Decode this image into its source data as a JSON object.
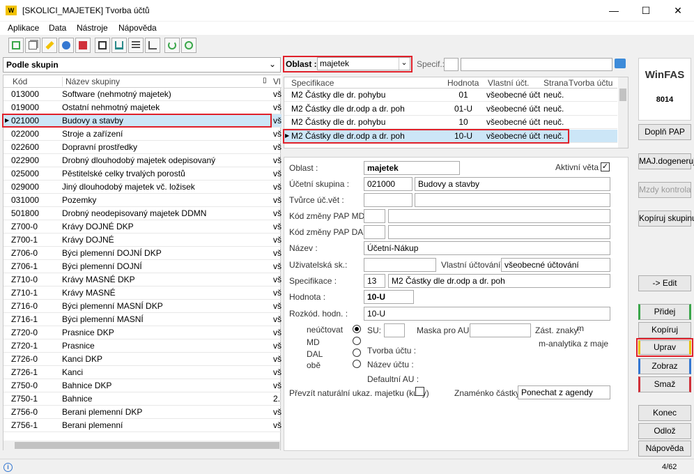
{
  "window": {
    "logo": "W",
    "title": "[SKOLICI_MAJETEK] Tvorba účtů",
    "min": "—",
    "max": "☐",
    "close": "✕"
  },
  "menu": [
    "Aplikace",
    "Data",
    "Nástroje",
    "Nápověda"
  ],
  "toolbar_icons": [
    "add-icon",
    "copy-icon",
    "edit-icon",
    "view-icon",
    "delete-icon",
    "print-icon",
    "export-icon",
    "list-icon",
    "tree-icon",
    "refresh-icon",
    "help-icon"
  ],
  "left": {
    "grouping": "Podle skupin",
    "headers": {
      "kod": "Kód",
      "nazev": "Název skupiny",
      "vl": "Vl"
    },
    "rows": [
      {
        "kod": "013000",
        "nazev": "Software (nehmotný majetek)",
        "vl": "vš"
      },
      {
        "kod": "019000",
        "nazev": "Ostatní nehmotný majetek",
        "vl": "vš"
      },
      {
        "kod": "021000",
        "nazev": "Budovy a stavby",
        "vl": "vš"
      },
      {
        "kod": "022000",
        "nazev": "Stroje a zařízení",
        "vl": "vš"
      },
      {
        "kod": "022600",
        "nazev": "Dopravní prostředky",
        "vl": "vš"
      },
      {
        "kod": "022900",
        "nazev": "Drobný dlouhodobý majetek odepisovaný",
        "vl": "vš"
      },
      {
        "kod": "025000",
        "nazev": "Pěstitelské celky trvalých porostů",
        "vl": "vš"
      },
      {
        "kod": "029000",
        "nazev": "Jiný dlouhodobý majetek vč. ložisek",
        "vl": "vš"
      },
      {
        "kod": "031000",
        "nazev": "Pozemky",
        "vl": "vš"
      },
      {
        "kod": "501800",
        "nazev": "Drobný neodepisovaný majetek DDMN",
        "vl": "vš"
      },
      {
        "kod": "Z700-0",
        "nazev": "Krávy DOJNÉ DKP",
        "vl": "vš"
      },
      {
        "kod": "Z700-1",
        "nazev": "Krávy DOJNÉ",
        "vl": "vš"
      },
      {
        "kod": "Z706-0",
        "nazev": "Býci plemenní DOJNÍ DKP",
        "vl": "vš"
      },
      {
        "kod": "Z706-1",
        "nazev": "Býci plemenní DOJNÍ",
        "vl": "vš"
      },
      {
        "kod": "Z710-0",
        "nazev": "Krávy MASNÉ DKP",
        "vl": "vš"
      },
      {
        "kod": "Z710-1",
        "nazev": "Krávy MASNÉ",
        "vl": "vš"
      },
      {
        "kod": "Z716-0",
        "nazev": "Býci plemenní MASNÍ DKP",
        "vl": "vš"
      },
      {
        "kod": "Z716-1",
        "nazev": "Býci plemenní MASNÍ",
        "vl": "vš"
      },
      {
        "kod": "Z720-0",
        "nazev": "Prasnice DKP",
        "vl": "vš"
      },
      {
        "kod": "Z720-1",
        "nazev": "Prasnice",
        "vl": "vš"
      },
      {
        "kod": "Z726-0",
        "nazev": "Kanci DKP",
        "vl": "vš"
      },
      {
        "kod": "Z726-1",
        "nazev": "Kanci",
        "vl": "vš"
      },
      {
        "kod": "Z750-0",
        "nazev": "Bahnice DKP",
        "vl": "vš"
      },
      {
        "kod": "Z750-1",
        "nazev": "Bahnice",
        "vl": "2."
      },
      {
        "kod": "Z756-0",
        "nazev": "Berani plemenní DKP",
        "vl": "vš"
      },
      {
        "kod": "Z756-1",
        "nazev": "Berani plemenní",
        "vl": "vš"
      }
    ]
  },
  "filter": {
    "oblast_label": "Oblast :",
    "oblast_value": "majetek",
    "specif_label": "Specif.:"
  },
  "spec": {
    "headers": {
      "spec": "Specifikace",
      "hod": "Hodnota",
      "vl": "Vlastní účt.",
      "str": "Strana",
      "tvorba": "Tvorba účtu"
    },
    "rows": [
      {
        "spec": "M2 Částky dle dr. pohybu",
        "hod": "01",
        "vl": "všeobecné účt",
        "str": "neuč."
      },
      {
        "spec": "M2 Částky dle dr.odp a dr. poh",
        "hod": "01-U",
        "vl": "všeobecné účt",
        "str": "neuč."
      },
      {
        "spec": "M2 Částky dle dr. pohybu",
        "hod": "10",
        "vl": "všeobecné účt",
        "str": "neuč."
      },
      {
        "spec": "M2 Částky dle dr.odp a dr. poh",
        "hod": "10-U",
        "vl": "všeobecné účt",
        "str": "neuč."
      }
    ]
  },
  "form": {
    "oblast_label": "Oblast :",
    "oblast": "majetek",
    "aktivni_label": "Aktivní věta",
    "aktivni_check": "✓",
    "ucetni_skupina_label": "Účetní skupina :",
    "ucetni_skupina": "021000",
    "ucetni_skupina_nazev": "Budovy a stavby",
    "tvurce_label": "Tvůrce úč.vět :",
    "pap_md_label": "Kód změny PAP MD :",
    "pap_dal_label": "Kód změny PAP DAL :",
    "nazev_label": "Název :",
    "nazev": "Účetní-Nákup",
    "uziv_label": "Uživatelská sk.:",
    "vlastni_label": "Vlastní účtování :",
    "vlastni": "všeobecné účtování",
    "spec_label": "Specifikace :",
    "spec_num": "13",
    "spec_text": "M2 Částky dle dr.odp a dr. poh",
    "hodnota_label": "Hodnota :",
    "hodnota": "10-U",
    "rozkod_label": "Rozkód. hodn. :",
    "rozkod": "10-U",
    "radio_labels": [
      "neúčtovat",
      "MD",
      "DAL",
      "obě"
    ],
    "su_label": "SU:",
    "maska_label": "Maska pro AU:",
    "zast_label": "Zást. znaky:",
    "zast_value": "m",
    "manalytika": "m-analytika z maje",
    "tvorba_label": "Tvorba účtu :",
    "nazev_uctu_label": "Název účtu :",
    "default_au_label": "Defaultní AU :",
    "prevzit_label": "Převzít naturální ukaz. majetku (kusy)",
    "znamenko_label": "Znaménko částky:",
    "znamenko": "Ponechat z agendy"
  },
  "right": {
    "brand": "WinFAS",
    "number": "8014",
    "buttons": [
      "Doplň PAP",
      "MAJ.dogeneruj",
      "Mzdy kontrola",
      "Kopíruj skupinu",
      "-> Edit",
      "Přidej",
      "Kopíruj",
      "Uprav",
      "Zobraz",
      "Smaž",
      "Konec",
      "Odlož",
      "Nápověda"
    ]
  },
  "status": {
    "info": "i",
    "page": "4/62"
  },
  "colors": {
    "accent_red": "#e0202a",
    "green": "#3aa64a",
    "blue": "#3477d1",
    "yellow": "#e8c200"
  }
}
